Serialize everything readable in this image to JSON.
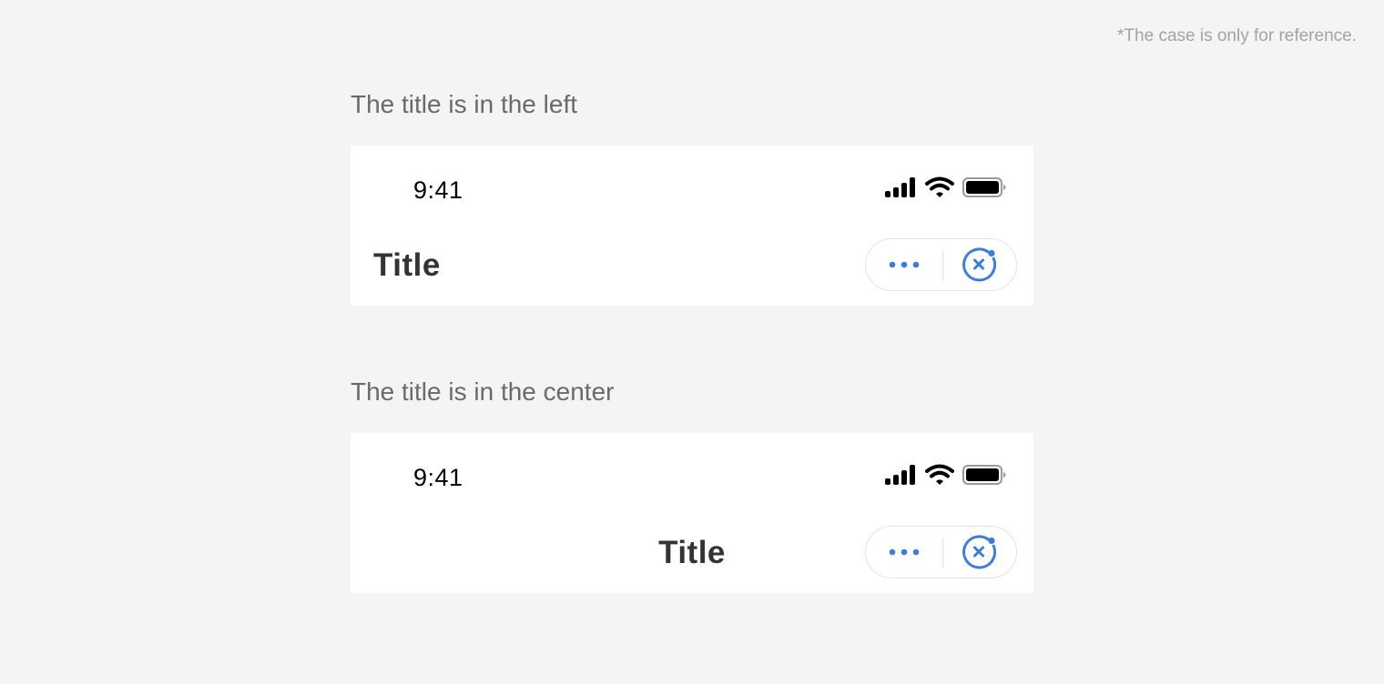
{
  "note": "*The case is only for reference.",
  "accent_color": "#3a7de0",
  "examples": [
    {
      "label": "The title is in the left",
      "status_time": "9:41",
      "title": "Title",
      "title_alignment": "left",
      "status_icons": [
        "signal-icon",
        "wifi-icon",
        "battery-icon"
      ],
      "capsule": [
        "more-icon",
        "close-icon"
      ]
    },
    {
      "label": "The title is in the center",
      "status_time": "9:41",
      "title": "Title",
      "title_alignment": "center",
      "status_icons": [
        "signal-icon",
        "wifi-icon",
        "battery-icon"
      ],
      "capsule": [
        "more-icon",
        "close-icon"
      ]
    }
  ]
}
